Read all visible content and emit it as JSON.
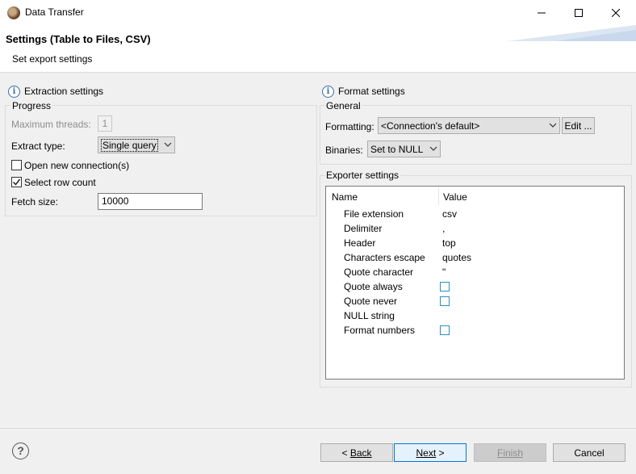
{
  "window": {
    "title": "Data Transfer"
  },
  "header": {
    "title": "Settings (Table to Files, CSV)",
    "subtitle": "Set export settings"
  },
  "extraction": {
    "title": "Extraction settings",
    "group": "Progress",
    "max_threads_label": "Maximum threads:",
    "max_threads_value": "1",
    "extract_type_label": "Extract type:",
    "extract_type_value": "Single query",
    "open_new_conn_label": "Open new connection(s)",
    "open_new_conn_checked": false,
    "select_row_count_label": "Select row count",
    "select_row_count_checked": true,
    "fetch_size_label": "Fetch size:",
    "fetch_size_value": "10000"
  },
  "format": {
    "title": "Format settings",
    "group": "General",
    "formatting_label": "Formatting:",
    "formatting_value": "<Connection's default>",
    "edit_label": "Edit ...",
    "binaries_label": "Binaries:",
    "binaries_value": "Set to NULL"
  },
  "exporter": {
    "group": "Exporter settings",
    "columns": [
      "Name",
      "Value"
    ],
    "rows": [
      {
        "name": "File extension",
        "value": "csv"
      },
      {
        "name": "Delimiter",
        "value": ","
      },
      {
        "name": "Header",
        "value": "top"
      },
      {
        "name": "Characters escape",
        "value": "quotes"
      },
      {
        "name": "Quote character",
        "value": "\""
      },
      {
        "name": "Quote always",
        "value": ""
      },
      {
        "name": "Quote never",
        "value": ""
      },
      {
        "name": "NULL string",
        "value": ""
      },
      {
        "name": "Format numbers",
        "value": ""
      }
    ]
  },
  "buttons": {
    "back": "Back",
    "back_prefix": "< ",
    "next": "Next",
    "next_suffix": " >",
    "finish": "Finish",
    "cancel": "Cancel"
  },
  "help": {
    "glyph": "?"
  }
}
